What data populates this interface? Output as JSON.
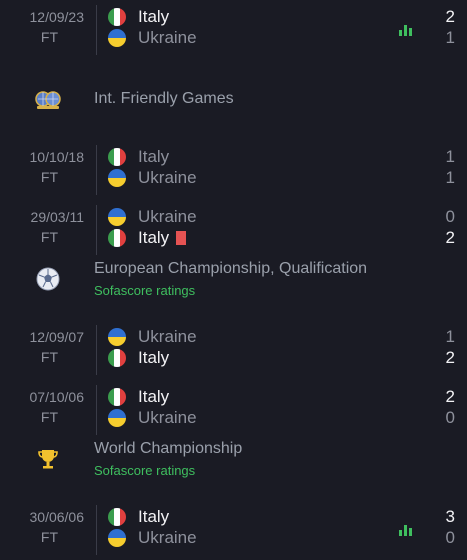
{
  "colors": {
    "background": "#1a1b24",
    "win_text": "#f2f2f5",
    "muted_text": "#8e919c",
    "accent_green": "#3fbf5f",
    "red_card": "#e55353"
  },
  "tournaments": [
    {
      "name": "Int. Friendly Games",
      "icon": "globe-trophy-icon"
    },
    {
      "name": "European Championship, Qualification",
      "subtitle": "Sofascore ratings",
      "icon": "soccer-ball-icon"
    },
    {
      "name": "World Championship",
      "subtitle": "Sofascore ratings",
      "icon": "trophy-icon"
    }
  ],
  "matches": [
    {
      "date": "12/09/23",
      "status": "FT",
      "home": "Italy",
      "home_flag": "italy",
      "away": "Ukraine",
      "away_flag": "ukraine",
      "home_score": "2",
      "away_score": "1",
      "winner": "home",
      "stats_icon": true
    },
    {
      "date": "10/10/18",
      "status": "FT",
      "home": "Italy",
      "home_flag": "italy",
      "away": "Ukraine",
      "away_flag": "ukraine",
      "home_score": "1",
      "away_score": "1",
      "winner": "none"
    },
    {
      "date": "29/03/11",
      "status": "FT",
      "home": "Ukraine",
      "home_flag": "ukraine",
      "away": "Italy",
      "away_flag": "italy",
      "home_score": "0",
      "away_score": "2",
      "winner": "away",
      "away_red_card": true
    },
    {
      "date": "12/09/07",
      "status": "FT",
      "home": "Ukraine",
      "home_flag": "ukraine",
      "away": "Italy",
      "away_flag": "italy",
      "home_score": "1",
      "away_score": "2",
      "winner": "away"
    },
    {
      "date": "07/10/06",
      "status": "FT",
      "home": "Italy",
      "home_flag": "italy",
      "away": "Ukraine",
      "away_flag": "ukraine",
      "home_score": "2",
      "away_score": "0",
      "winner": "home"
    },
    {
      "date": "30/06/06",
      "status": "FT",
      "home": "Italy",
      "home_flag": "italy",
      "away": "Ukraine",
      "away_flag": "ukraine",
      "home_score": "3",
      "away_score": "0",
      "winner": "home",
      "stats_icon": true
    }
  ]
}
